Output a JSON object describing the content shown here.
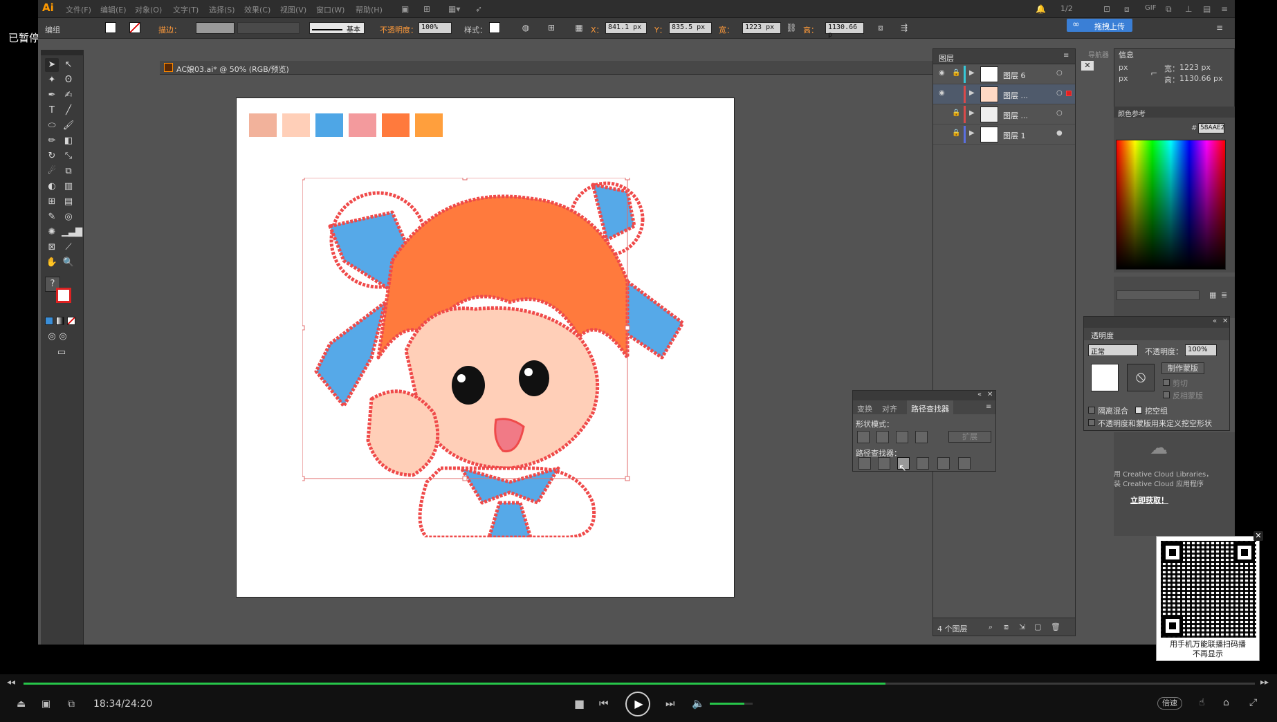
{
  "player": {
    "paused_label": "已暂停",
    "time": "18:34/24:20",
    "progress": 0.7,
    "volume": 0.8,
    "speed_label": "倍速"
  },
  "app": {
    "logo": "Ai",
    "menu": [
      "文件(F)",
      "编辑(E)",
      "对象(O)",
      "文字(T)",
      "选择(S)",
      "效果(C)",
      "视图(V)",
      "窗口(W)",
      "帮助(H)"
    ],
    "page_counter": "1/2",
    "upload_label": "拖拽上传"
  },
  "options_bar": {
    "group_label": "编组",
    "stroke_label": "描边：",
    "brush_label": "基本",
    "opacity_label": "不透明度：",
    "opacity_value": "100%",
    "style_label": "样式：",
    "x_label": "X：",
    "x_value": "841.1 px",
    "y_label": "Y：",
    "y_value": "835.5 px",
    "w_label": "宽：",
    "w_value": "1223 px",
    "h_label": "高：",
    "h_value": "1130.66 p"
  },
  "document": {
    "title": "AC娘03.ai* @ 50% (RGB/预览)",
    "palette": [
      "#f2b29b",
      "#ffcfb8",
      "#4ea6e6",
      "#f39a9d",
      "#ff7a3d",
      "#ff9f3d"
    ],
    "artwork_colors": {
      "hair": "#ff7a3d",
      "skin": "#ffcfb8",
      "blue": "#56a9e8",
      "outline": "#ef4a4a",
      "selection": "#e26a6a"
    }
  },
  "layers_panel": {
    "title": "图层",
    "layers": [
      {
        "name": "图层 6",
        "color": "#36c8d8",
        "selected": false,
        "visible": true,
        "locked": true
      },
      {
        "name": "图层 ...",
        "color": "#d94a4a",
        "selected": true,
        "visible": true,
        "locked": false
      },
      {
        "name": "图层 ...",
        "color": "#d94a4a",
        "selected": false,
        "visible": false,
        "locked": true
      },
      {
        "name": "图层 1",
        "color": "#5a6fe0",
        "selected": false,
        "visible": false,
        "locked": true
      }
    ],
    "footer_count": "4 个图层"
  },
  "info_panel": {
    "tab_nav": "导航器",
    "tab_info": "信息",
    "x_unit": "px",
    "y_unit": "px",
    "w_label": "宽：",
    "w_value": "1223 px",
    "h_label": "高：",
    "h_value": "1130.66 px"
  },
  "color_panel": {
    "title": "颜色参考",
    "hex_label": "#",
    "hex_value": "58AAE2"
  },
  "transparency_panel": {
    "title": "透明度",
    "blend_mode": "正常",
    "opacity_label": "不透明度：",
    "opacity_value": "100%",
    "make_mask": "制作蒙版",
    "clip": "剪切",
    "invert_mask": "反相蒙版",
    "isolate_blending": "隔离混合",
    "knockout_group": "挖空组",
    "opacity_mask_define": "不透明度和蒙版用来定义挖空形状"
  },
  "cc_libraries": {
    "line1": "用 Creative Cloud Libraries，",
    "line2": "装 Creative Cloud 应用程序",
    "link": "立即获取！"
  },
  "pathfinder_panel": {
    "tabs": [
      "变换",
      "对齐",
      "路径查找器"
    ],
    "active_tab": 2,
    "shape_modes_label": "形状模式：",
    "expand_label": "扩展",
    "pathfinders_label": "路径查找器："
  },
  "qr_popup": {
    "line1": "用手机万能联播扫码播",
    "line2": "不再显示",
    "close": "✕"
  }
}
